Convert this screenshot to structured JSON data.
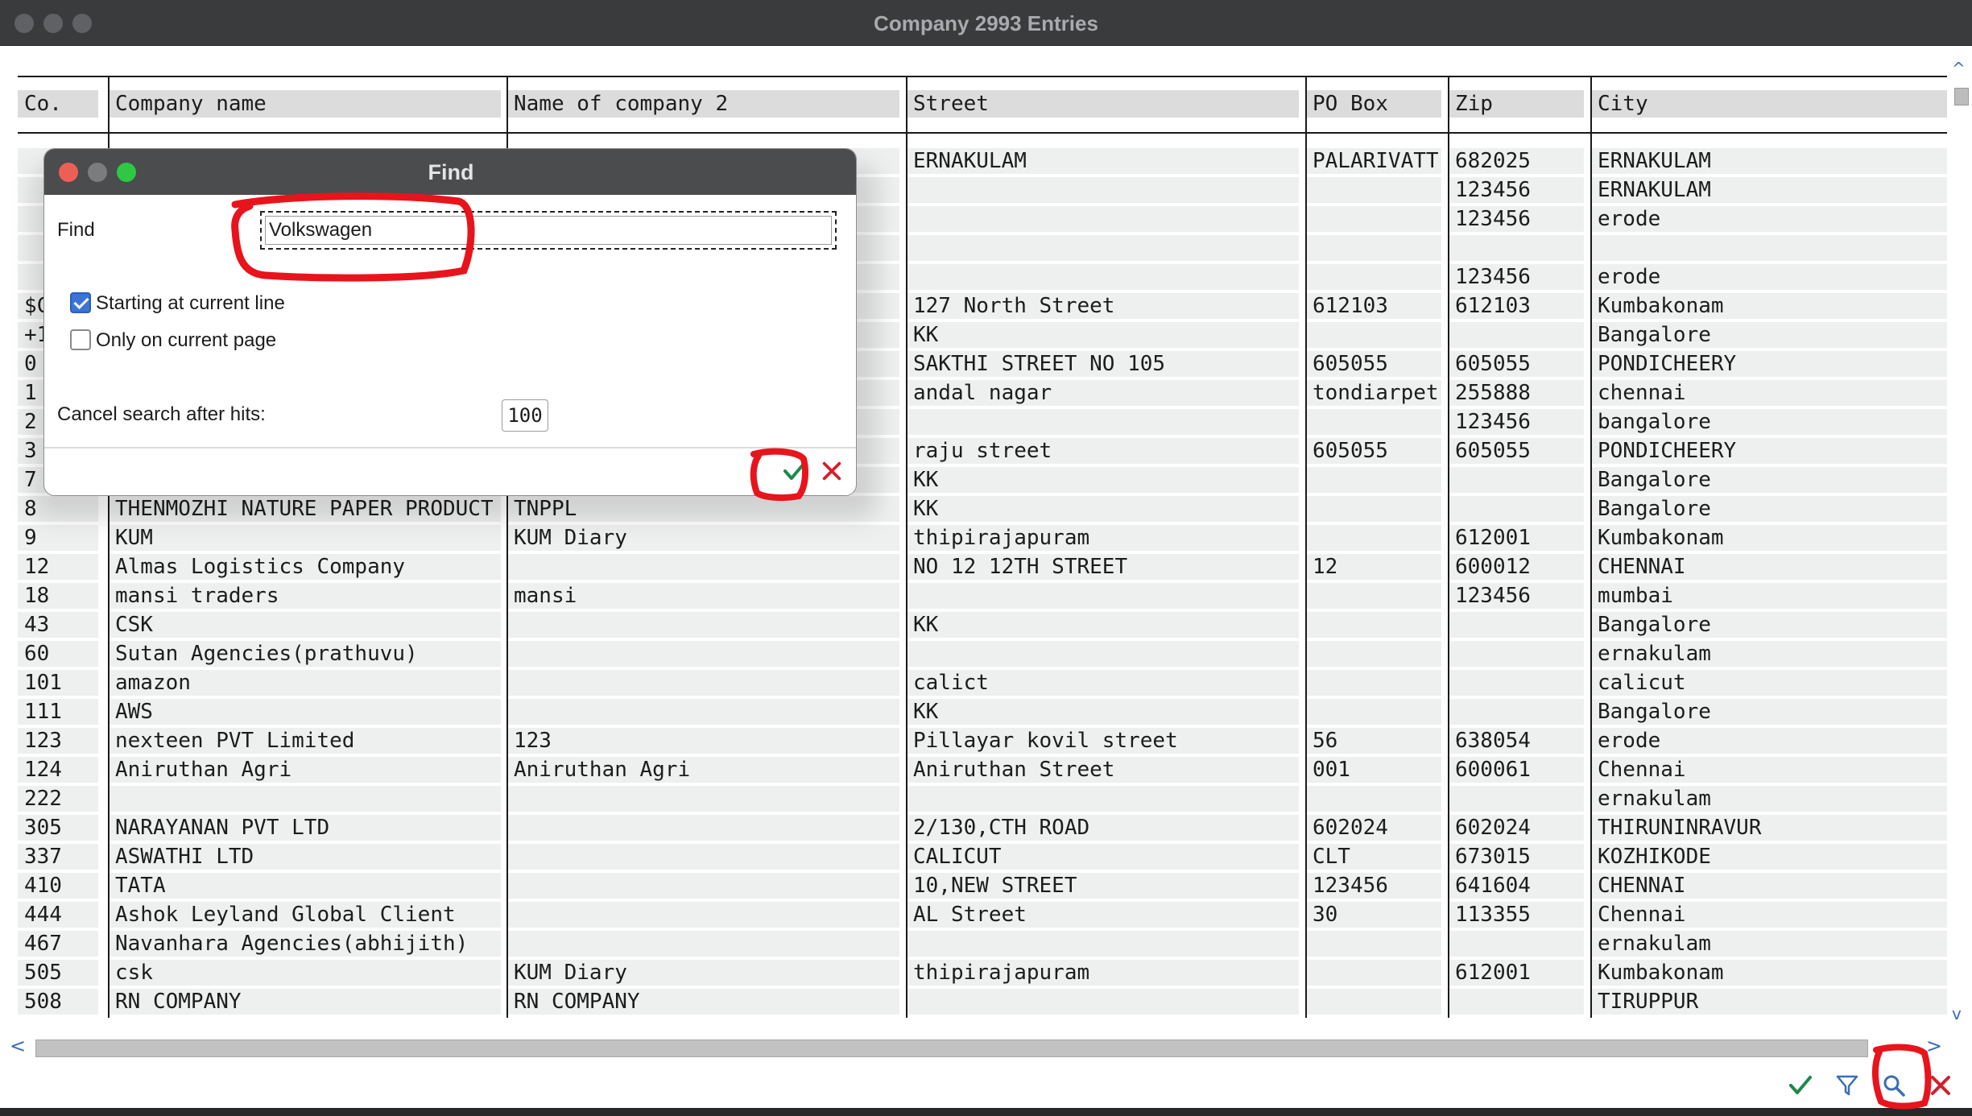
{
  "window": {
    "title": "Company 2993 Entries"
  },
  "columns": [
    "Co.",
    "Company name",
    "Name of company 2",
    "Street",
    "PO Box",
    "Zip",
    "City"
  ],
  "rows": [
    [
      "",
      "",
      "",
      "ERNAKULAM",
      "PALARIVATT",
      "682025",
      "ERNAKULAM"
    ],
    [
      "",
      "",
      "",
      "",
      "",
      "123456",
      "ERNAKULAM"
    ],
    [
      "",
      "",
      "",
      "",
      "",
      "123456",
      "erode"
    ],
    [
      "",
      "",
      "",
      "",
      "",
      "",
      ""
    ],
    [
      "",
      "",
      "",
      "",
      "",
      "123456",
      "erode"
    ],
    [
      "$C",
      "",
      "",
      "127 North Street",
      "612103",
      "612103",
      "Kumbakonam"
    ],
    [
      "+1",
      "",
      "",
      "KK",
      "",
      "",
      "Bangalore"
    ],
    [
      "0",
      "",
      "",
      "SAKTHI STREET NO 105",
      "605055",
      "605055",
      "PONDICHEERY"
    ],
    [
      "1",
      "",
      "",
      "andal nagar",
      "tondiarpet",
      "255888",
      "chennai"
    ],
    [
      "2",
      "",
      "",
      "",
      "",
      "123456",
      "bangalore"
    ],
    [
      "3",
      "",
      "",
      "raju street",
      "605055",
      "605055",
      "PONDICHEERY"
    ],
    [
      "7",
      "",
      "",
      "KK",
      "",
      "",
      "Bangalore"
    ],
    [
      "8",
      "THENMOZHI NATURE PAPER PRODUCT",
      "TNPPL",
      "KK",
      "",
      "",
      "Bangalore"
    ],
    [
      "9",
      "KUM",
      "KUM Diary",
      "thipirajapuram",
      "",
      "612001",
      "Kumbakonam"
    ],
    [
      "12",
      "Almas Logistics Company",
      "",
      "NO 12 12TH STREET",
      "12",
      "600012",
      "CHENNAI"
    ],
    [
      "18",
      "mansi traders",
      "mansi",
      "",
      "",
      "123456",
      "mumbai"
    ],
    [
      "43",
      "CSK",
      "",
      "KK",
      "",
      "",
      "Bangalore"
    ],
    [
      "60",
      "Sutan Agencies(prathuvu)",
      "",
      "",
      "",
      "",
      "ernakulam"
    ],
    [
      "101",
      "amazon",
      "",
      "calict",
      "",
      "",
      "calicut"
    ],
    [
      "111",
      "AWS",
      "",
      "KK",
      "",
      "",
      "Bangalore"
    ],
    [
      "123",
      "nexteen PVT Limited",
      "123",
      "Pillayar kovil street",
      "56",
      "638054",
      "erode"
    ],
    [
      "124",
      "Aniruthan Agri",
      "Aniruthan Agri",
      "Aniruthan Street",
      "001",
      "600061",
      "Chennai"
    ],
    [
      "222",
      "",
      "",
      "",
      "",
      "",
      "ernakulam"
    ],
    [
      "305",
      "NARAYANAN PVT LTD",
      "",
      "2/130,CTH ROAD",
      "602024",
      "602024",
      "THIRUNINRAVUR"
    ],
    [
      "337",
      "ASWATHI LTD",
      "",
      "CALICUT",
      "CLT",
      "673015",
      "KOZHIKODE"
    ],
    [
      "410",
      "TATA",
      "",
      "10,NEW STREET",
      "123456",
      "641604",
      "CHENNAI"
    ],
    [
      "444",
      "Ashok Leyland Global Client",
      "",
      "AL Street",
      "30",
      "113355",
      "Chennai"
    ],
    [
      "467",
      "Navanhara Agencies(abhijith)",
      "",
      "",
      "",
      "",
      "ernakulam"
    ],
    [
      "505",
      "csk",
      "KUM Diary",
      "thipirajapuram",
      "",
      "612001",
      "Kumbakonam"
    ],
    [
      "508",
      "RN COMPANY",
      "RN COMPANY",
      "",
      "",
      "",
      "TIRUPPUR"
    ]
  ],
  "scroll": {
    "up": "^",
    "down": "v",
    "left": "<",
    "right": ">"
  },
  "dialog": {
    "title": "Find",
    "find_label": "Find",
    "find_value": "Volkswagen",
    "opt_current_line": "Starting at current line",
    "opt_current_line_checked": true,
    "opt_current_page": "Only on current page",
    "opt_current_page_checked": false,
    "cancel_after_label": "Cancel search after hits:",
    "cancel_after_value": "100"
  },
  "colors": {
    "accent_green": "#1b8a4a",
    "cancel_red": "#d41f2a",
    "filter_blue": "#3a6db5",
    "annotation_red": "#e8141c"
  }
}
